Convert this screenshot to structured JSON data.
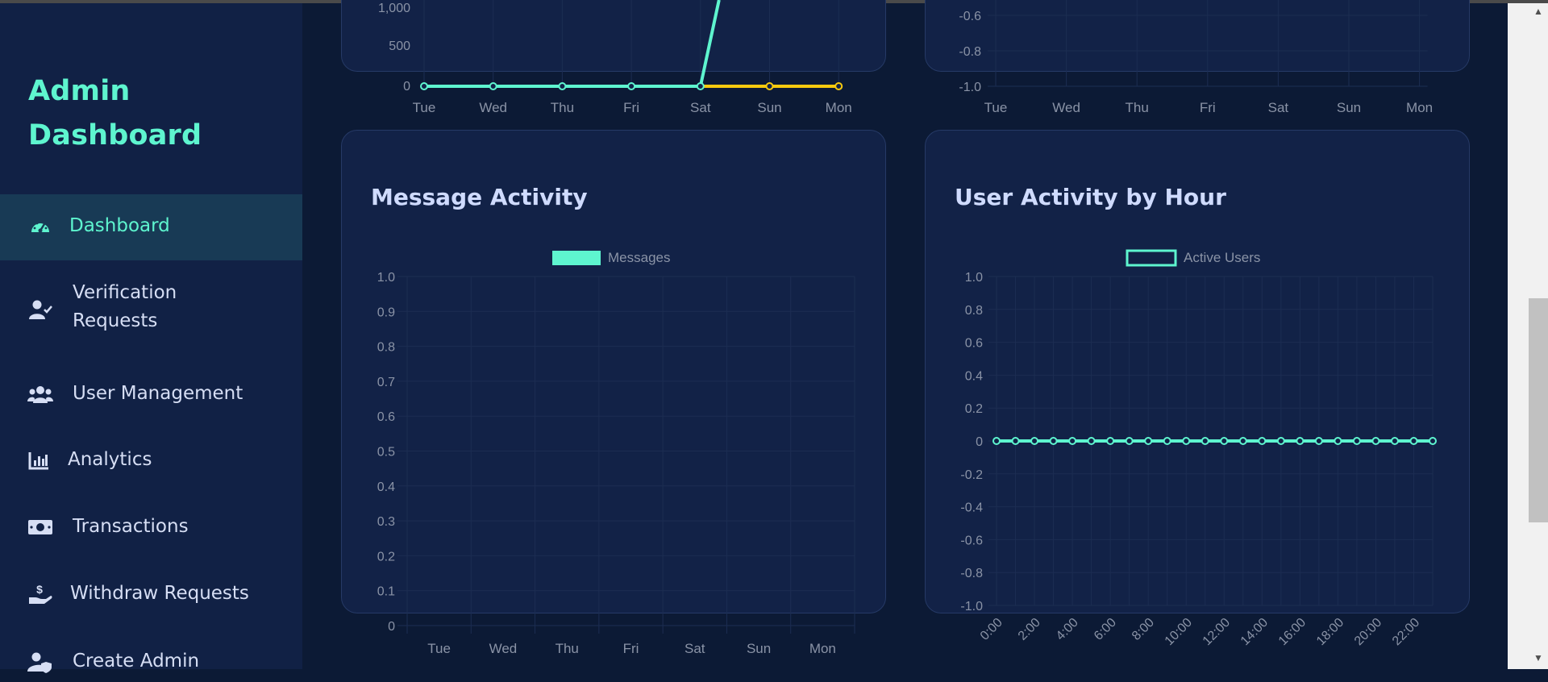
{
  "sidebar": {
    "brand_line1": "Admin",
    "brand_line2": "Dashboard",
    "items": [
      {
        "label_lines": [
          "Dashboard"
        ],
        "icon": "gauge-icon",
        "active": true
      },
      {
        "label_lines": [
          "Verification",
          "Requests"
        ],
        "icon": "user-check-icon",
        "active": false
      },
      {
        "label_lines": [
          "User Management"
        ],
        "icon": "users-icon",
        "active": false
      },
      {
        "label_lines": [
          "Analytics"
        ],
        "icon": "bar-chart-icon",
        "active": false
      },
      {
        "label_lines": [
          "Transactions"
        ],
        "icon": "money-bill-icon",
        "active": false
      },
      {
        "label_lines": [
          "Withdraw Requests"
        ],
        "icon": "hand-dollar-icon",
        "active": false
      },
      {
        "label_lines": [
          "Create Admin"
        ],
        "icon": "user-shield-icon",
        "active": false
      }
    ]
  },
  "colors": {
    "accent": "#5ef5cf",
    "yellow": "#f6c90e",
    "card": "#122247",
    "grid": "#1c2d52",
    "tick": "#8a93a6"
  },
  "chart_data": [
    {
      "type": "line",
      "title": "",
      "categories": [
        "Tue",
        "Wed",
        "Thu",
        "Fri",
        "Sat",
        "Sun",
        "Mon"
      ],
      "y_ticks_visible": [
        "1,000",
        "500",
        "0"
      ],
      "series": [
        {
          "values": [
            0,
            0,
            0,
            0,
            0,
            null,
            null
          ],
          "color": "#5ef5cf",
          "note_continuation": "rises steeply after Sat"
        },
        {
          "values": [
            null,
            null,
            null,
            null,
            0,
            0,
            0
          ],
          "color": "#f6c90e"
        }
      ]
    },
    {
      "type": "line",
      "title": "",
      "categories": [
        "Tue",
        "Wed",
        "Thu",
        "Fri",
        "Sat",
        "Sun",
        "Mon"
      ],
      "y_ticks_visible": [
        "-0.6",
        "-0.8",
        "-1.0"
      ]
    },
    {
      "type": "bar",
      "title": "Message Activity",
      "legend": [
        "Messages"
      ],
      "categories": [
        "Tue",
        "Wed",
        "Thu",
        "Fri",
        "Sat",
        "Sun",
        "Mon"
      ],
      "y_ticks": [
        "1.0",
        "0.9",
        "0.8",
        "0.7",
        "0.6",
        "0.5",
        "0.4",
        "0.3",
        "0.2",
        "0.1",
        "0"
      ],
      "ylim": [
        0,
        1
      ],
      "series": [
        {
          "name": "Messages",
          "values": [
            0,
            0,
            0,
            0,
            0,
            0,
            0
          ]
        }
      ]
    },
    {
      "type": "line",
      "title": "User Activity by Hour",
      "legend": [
        "Active Users"
      ],
      "x_ticks": [
        "0:00",
        "2:00",
        "4:00",
        "6:00",
        "8:00",
        "10:00",
        "12:00",
        "14:00",
        "16:00",
        "18:00",
        "20:00",
        "22:00"
      ],
      "y_ticks": [
        "1.0",
        "0.8",
        "0.6",
        "0.4",
        "0.2",
        "0",
        "-0.2",
        "-0.4",
        "-0.6",
        "-0.8",
        "-1.0"
      ],
      "ylim": [
        -1,
        1
      ],
      "series": [
        {
          "name": "Active Users",
          "values": [
            0,
            0,
            0,
            0,
            0,
            0,
            0,
            0,
            0,
            0,
            0,
            0,
            0,
            0,
            0,
            0,
            0,
            0,
            0,
            0,
            0,
            0,
            0,
            0
          ]
        }
      ]
    }
  ]
}
